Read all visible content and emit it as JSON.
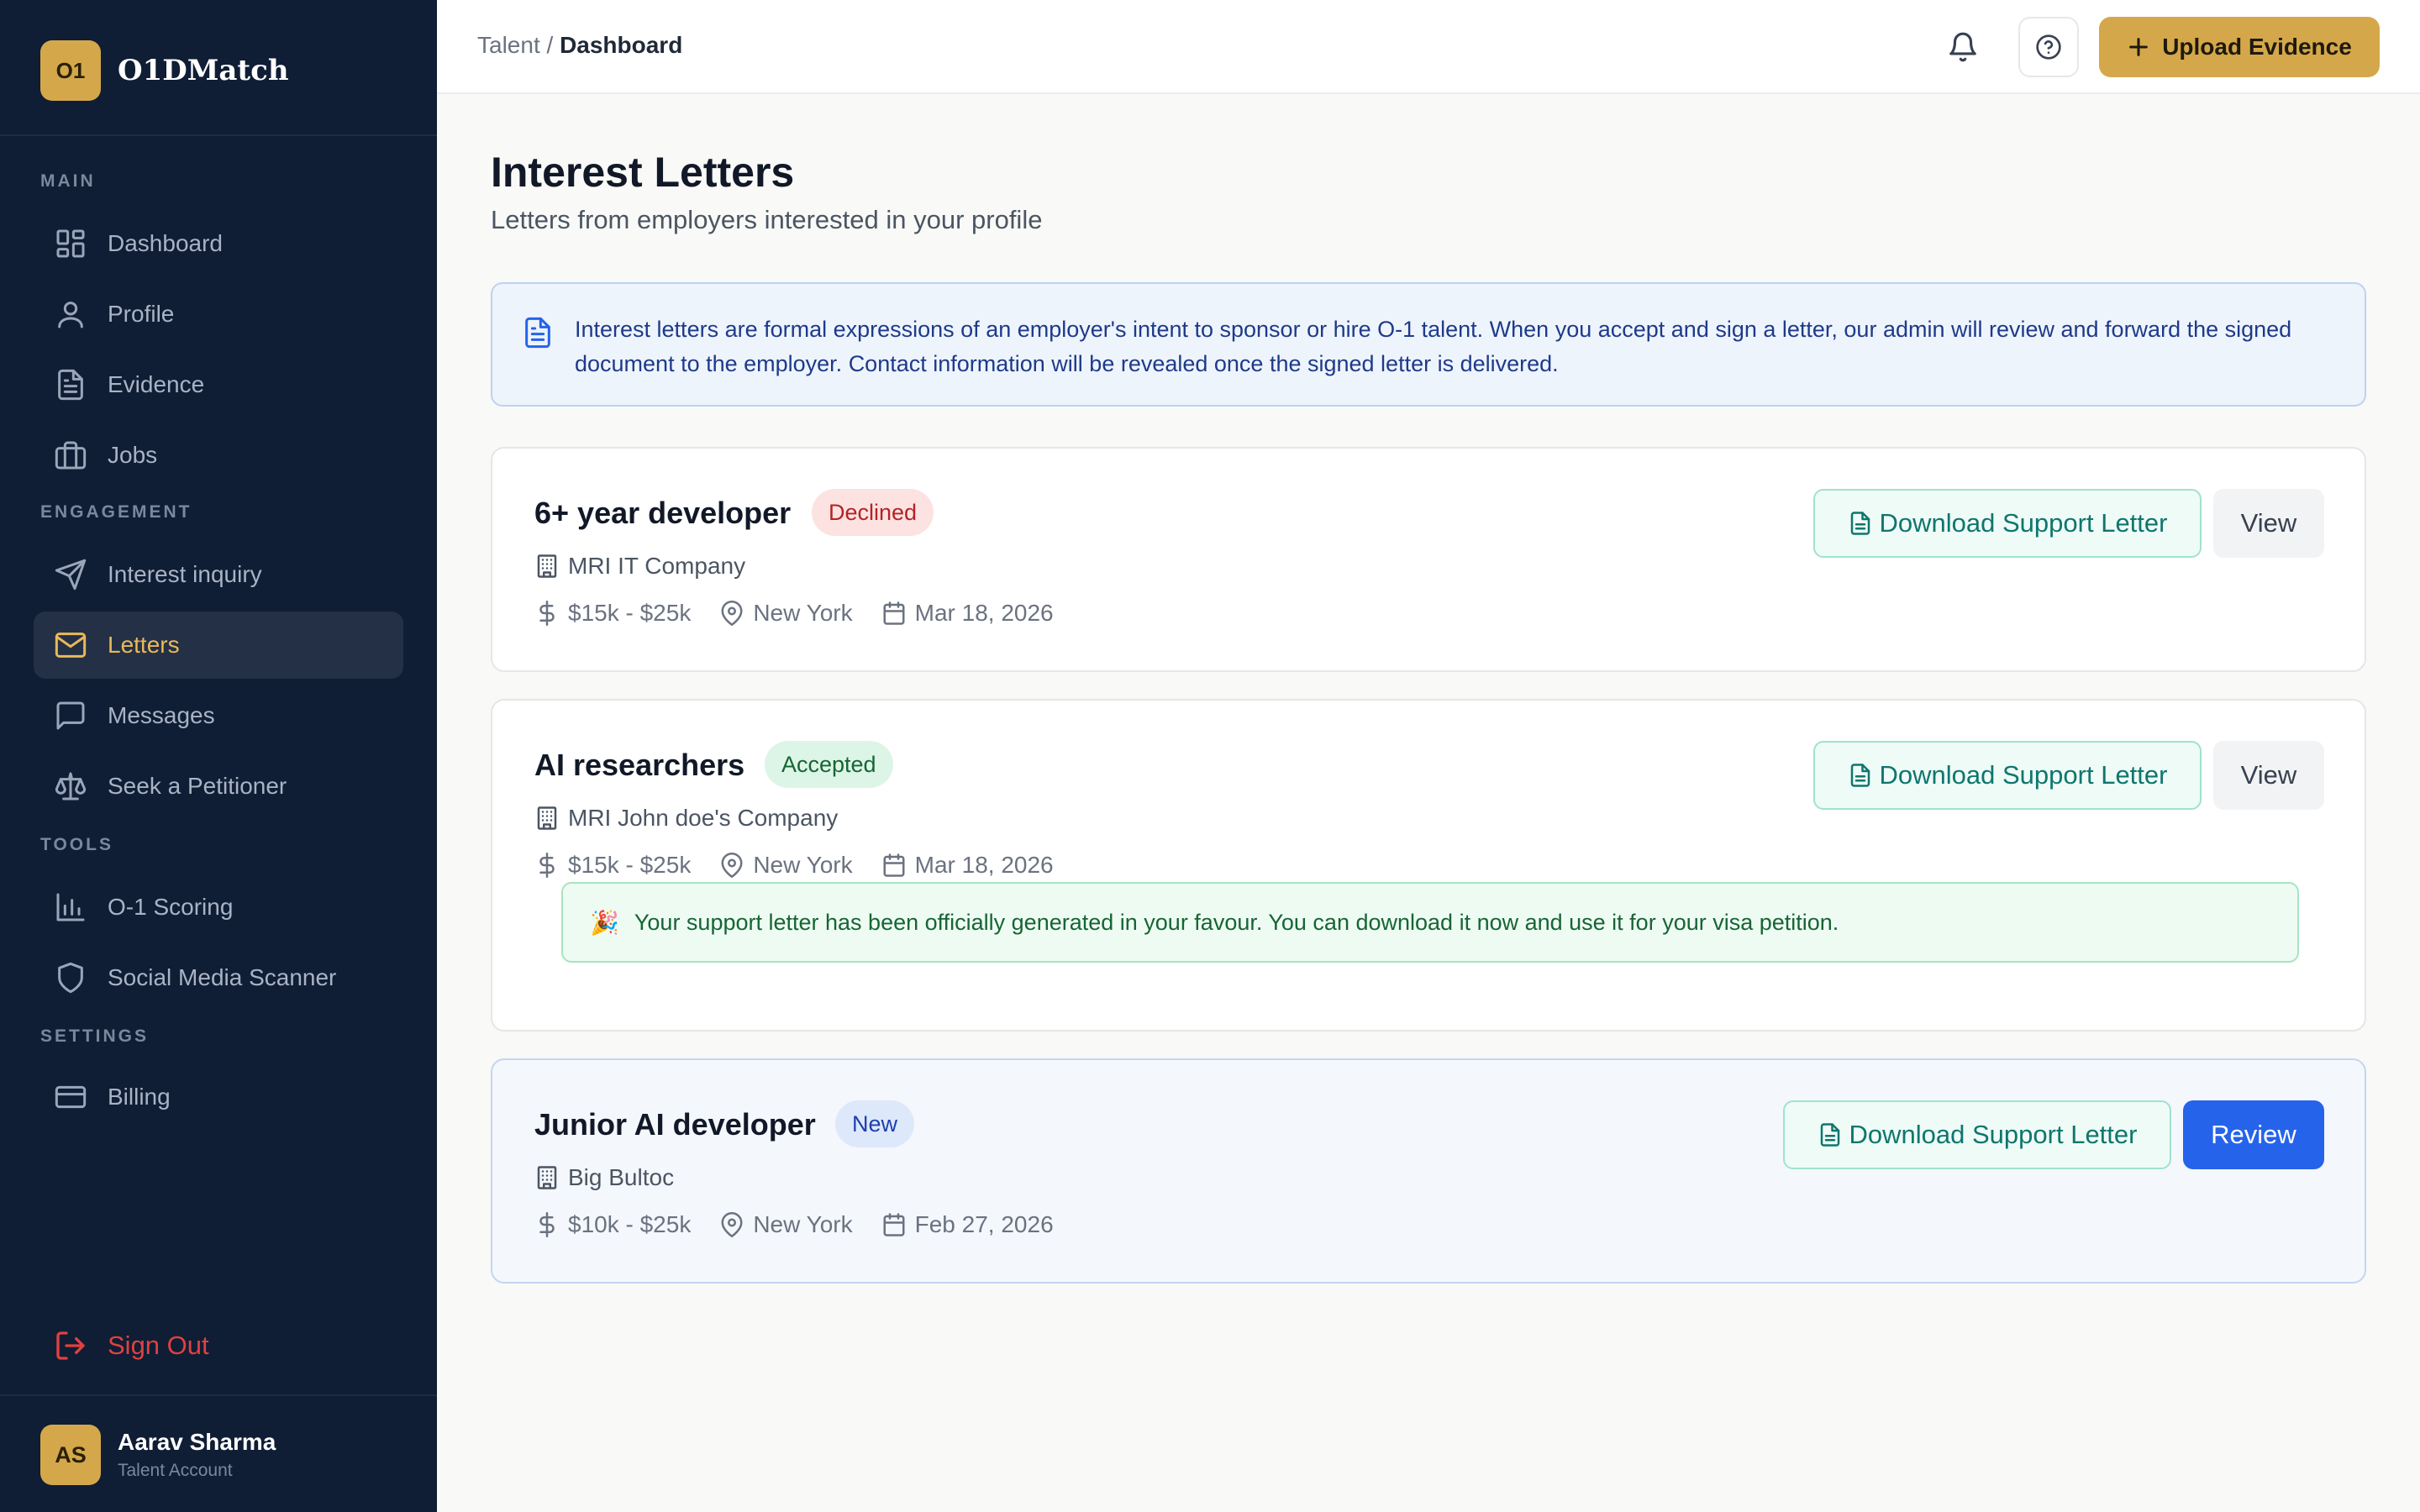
{
  "brand": {
    "logo": "O1",
    "name": "O1DMatch"
  },
  "sidebar": {
    "sections": [
      {
        "label": "MAIN",
        "items": [
          {
            "label": "Dashboard",
            "icon": "dashboard-icon"
          },
          {
            "label": "Profile",
            "icon": "user-icon"
          },
          {
            "label": "Evidence",
            "icon": "file-text-icon"
          },
          {
            "label": "Jobs",
            "icon": "briefcase-icon"
          }
        ]
      },
      {
        "label": "ENGAGEMENT",
        "items": [
          {
            "label": "Interest inquiry",
            "icon": "send-icon"
          },
          {
            "label": "Letters",
            "icon": "mail-icon",
            "active": true
          },
          {
            "label": "Messages",
            "icon": "message-icon"
          },
          {
            "label": "Seek a Petitioner",
            "icon": "scale-icon"
          }
        ]
      },
      {
        "label": "TOOLS",
        "items": [
          {
            "label": "O-1 Scoring",
            "icon": "bar-chart-icon"
          },
          {
            "label": "Social Media Scanner",
            "icon": "shield-icon"
          }
        ]
      },
      {
        "label": "SETTINGS",
        "items": [
          {
            "label": "Billing",
            "icon": "credit-card-icon"
          }
        ]
      }
    ],
    "sign_out": "Sign Out",
    "user": {
      "initials": "AS",
      "name": "Aarav Sharma",
      "role": "Talent Account"
    }
  },
  "header": {
    "breadcrumb_parent": "Talent /",
    "breadcrumb_current": "Dashboard",
    "upload_label": "Upload Evidence"
  },
  "page": {
    "title": "Interest Letters",
    "subtitle": "Letters from employers interested in your profile",
    "info": "Interest letters are formal expressions of an employer's intent to sponsor or hire O-1 talent. When you accept and sign a letter, our admin will review and forward the signed document to the employer. Contact information will be revealed once the signed letter is delivered."
  },
  "letters": [
    {
      "title": "6+ year developer",
      "status": "Declined",
      "company": "MRI IT Company",
      "salary": "$15k - $25k",
      "location": "New York",
      "date": "Mar 18, 2026",
      "download_label": "Download Support Letter",
      "action_label": "View"
    },
    {
      "title": "AI researchers",
      "status": "Accepted",
      "company": "MRI John doe's Company",
      "salary": "$15k - $25k",
      "location": "New York",
      "date": "Mar 18, 2026",
      "download_label": "Download Support Letter",
      "action_label": "View",
      "success_message": "Your support letter has been officially generated in your favour. You can download it now and use it for your visa petition.",
      "success_emoji": "🎉"
    },
    {
      "title": "Junior AI developer",
      "status": "New",
      "company": "Big Bultoc",
      "salary": "$10k - $25k",
      "location": "New York",
      "date": "Feb 27, 2026",
      "download_label": "Download Support Letter",
      "action_label": "Review"
    }
  ],
  "colors": {
    "sidebar_bg": "#0f1d35",
    "accent": "#d4a84a",
    "active_text": "#e9b95a",
    "primary_blue": "#2563eb",
    "teal": "#0f766e",
    "danger": "#e0413f"
  }
}
